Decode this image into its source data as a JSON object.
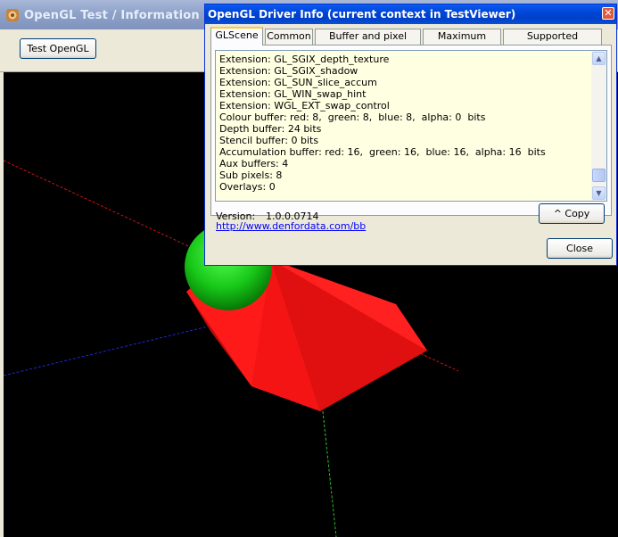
{
  "main_window": {
    "title": "OpenGL Test / Information",
    "test_button_label": "Test OpenGL"
  },
  "dialog": {
    "title": "OpenGL Driver Info (current context in TestViewer)",
    "close_glyph": "✕",
    "tabs": [
      {
        "label": "GLScene"
      },
      {
        "label": "Common"
      },
      {
        "label": "Buffer and pixel depths"
      },
      {
        "label": "Maximum values"
      },
      {
        "label": "Supported extensions"
      }
    ],
    "active_tab": "GLScene",
    "memo_lines": [
      "Extension: GL_SGIX_depth_texture",
      "Extension: GL_SGIX_shadow",
      "Extension: GL_SUN_slice_accum",
      "Extension: GL_WIN_swap_hint",
      "Extension: WGL_EXT_swap_control",
      "Colour buffer: red: 8,  green: 8,  blue: 8,  alpha: 0  bits",
      "Depth buffer: 24 bits",
      "Stencil buffer: 0 bits",
      "Accumulation buffer: red: 16,  green: 16,  blue: 16,  alpha: 16  bits",
      "Aux buffers: 4",
      "Sub pixels: 8",
      "Overlays: 0"
    ],
    "version_label": "Version:",
    "version_value": "1.0.0.0714",
    "homepage_link": "http://www.denfordata.com/bb",
    "copy_button_label": "^ Copy",
    "close_button_label": "Close"
  },
  "scene": {
    "background": "#000000",
    "axis_colors": {
      "x": "#d01010",
      "y": "#20b020",
      "z": "#1020c0"
    },
    "shapes": [
      "red-octahedron",
      "green-sphere"
    ],
    "colors": {
      "octahedron": "#ff1a1a",
      "sphere": "#20d020"
    }
  },
  "icons": {
    "app_icon": "app-icon",
    "scroll_up": "arrow-up-icon",
    "scroll_down": "arrow-down-icon"
  }
}
